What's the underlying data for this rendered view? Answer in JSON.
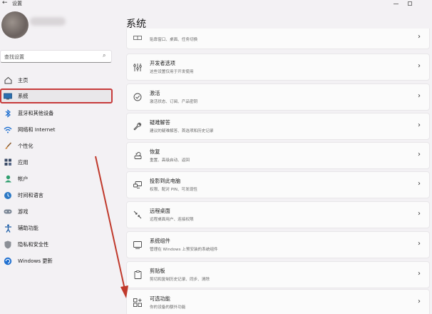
{
  "window": {
    "back_icon": "back-arrow-icon",
    "title": "设置"
  },
  "search": {
    "placeholder": "查找设置"
  },
  "sidebar": {
    "items": [
      {
        "label": "主页",
        "icon": "home-icon"
      },
      {
        "label": "系统",
        "icon": "system-icon",
        "selected": true
      },
      {
        "label": "蓝牙和其他设备",
        "icon": "bluetooth-icon"
      },
      {
        "label": "网络和 Internet",
        "icon": "network-icon"
      },
      {
        "label": "个性化",
        "icon": "brush-icon"
      },
      {
        "label": "应用",
        "icon": "apps-icon"
      },
      {
        "label": "帐户",
        "icon": "account-icon"
      },
      {
        "label": "时间和语言",
        "icon": "globe-clock-icon"
      },
      {
        "label": "游戏",
        "icon": "gamepad-icon"
      },
      {
        "label": "辅助功能",
        "icon": "accessibility-icon"
      },
      {
        "label": "隐私和安全性",
        "icon": "shield-icon"
      },
      {
        "label": "Windows 更新",
        "icon": "windows-update-icon"
      }
    ]
  },
  "main": {
    "title": "系统",
    "cards": [
      {
        "title": "",
        "desc": "贴靠窗口、桌面、任务切换",
        "icon": "multitasking-icon"
      },
      {
        "title": "开发者选项",
        "desc": "这些设置仅用于开发使用",
        "icon": "developer-icon"
      },
      {
        "title": "激活",
        "desc": "激活状态、订阅、产品密钥",
        "icon": "activation-icon"
      },
      {
        "title": "疑难解答",
        "desc": "建议的疑难解答、首选项和历史记录",
        "icon": "wrench-icon"
      },
      {
        "title": "恢复",
        "desc": "重置、高级启动、返回",
        "icon": "recovery-icon"
      },
      {
        "title": "投影到此电脑",
        "desc": "权限、配对 PIN、可发现性",
        "icon": "projection-icon"
      },
      {
        "title": "远程桌面",
        "desc": "远程桌面用户、连接权限",
        "icon": "remote-desktop-icon"
      },
      {
        "title": "系统组件",
        "desc": "管理在 Windows 上预安装的系统组件",
        "icon": "system-components-icon"
      },
      {
        "title": "剪贴板",
        "desc": "剪切和复制历史记录、同步、清除",
        "icon": "clipboard-icon"
      },
      {
        "title": "可选功能",
        "desc": "你的设备的额外功能",
        "icon": "optional-features-icon"
      }
    ]
  },
  "colors": {
    "highlight_border": "#c73b3b",
    "annotation_arrow": "#c0392b",
    "card_bg": "#fbfbfb",
    "page_bg": "#f3f1f4"
  }
}
